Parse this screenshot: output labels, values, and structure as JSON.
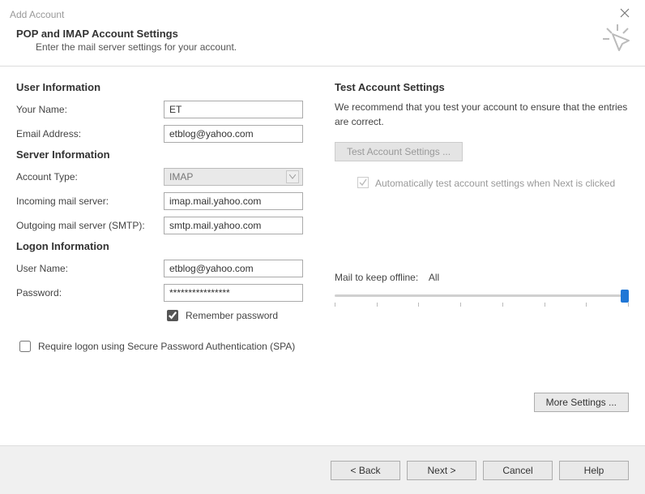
{
  "window": {
    "title": "Add Account"
  },
  "header": {
    "title": "POP and IMAP Account Settings",
    "subtitle": "Enter the mail server settings for your account."
  },
  "left": {
    "user_info_heading": "User Information",
    "your_name_label": "Your Name:",
    "your_name_value": "ET",
    "email_label": "Email Address:",
    "email_value": "etblog@yahoo.com",
    "server_info_heading": "Server Information",
    "account_type_label": "Account Type:",
    "account_type_value": "IMAP",
    "incoming_label": "Incoming mail server:",
    "incoming_value": "imap.mail.yahoo.com",
    "outgoing_label": "Outgoing mail server (SMTP):",
    "outgoing_value": "smtp.mail.yahoo.com",
    "logon_info_heading": "Logon Information",
    "username_label": "User Name:",
    "username_value": "etblog@yahoo.com",
    "password_label": "Password:",
    "password_value": "****************",
    "remember_label": "Remember password",
    "spa_label": "Require logon using Secure Password Authentication (SPA)"
  },
  "right": {
    "test_heading": "Test Account Settings",
    "test_desc": "We recommend that you test your account to ensure that the entries are correct.",
    "test_button": "Test Account Settings ...",
    "auto_test_label": "Automatically test account settings when Next is clicked",
    "mail_offline_label": "Mail to keep offline:",
    "mail_offline_value": "All",
    "more_settings": "More Settings ..."
  },
  "footer": {
    "back": "< Back",
    "next": "Next >",
    "cancel": "Cancel",
    "help": "Help"
  }
}
